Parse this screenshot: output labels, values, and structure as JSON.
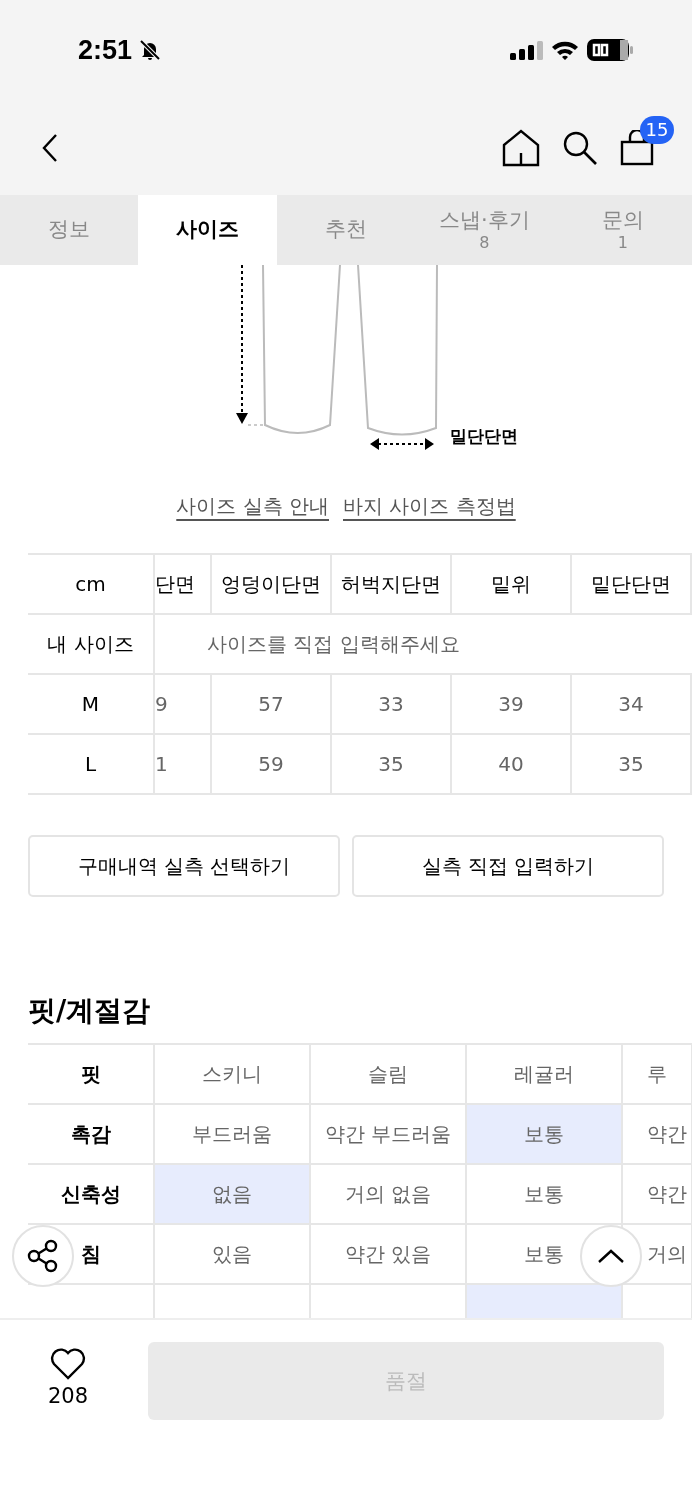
{
  "status_bar": {
    "time": "2:51"
  },
  "nav": {
    "cart_count": "15"
  },
  "tabs": [
    {
      "label": "정보",
      "selected": false
    },
    {
      "label": "사이즈",
      "selected": true
    },
    {
      "label": "추천",
      "selected": false
    },
    {
      "label": "스냅·후기",
      "count": "8",
      "selected": false
    },
    {
      "label": "문의",
      "count": "1",
      "selected": false
    }
  ],
  "diagram": {
    "label": "밀단단면"
  },
  "links": [
    "사이즈 실측 안내",
    "바지 사이즈 측정법"
  ],
  "size_table": {
    "corner": "cm",
    "columns": [
      "단면",
      "엉덩이단면",
      "허벅지단면",
      "밑위",
      "밑단단면"
    ],
    "my_size": {
      "label": "내 사이즈",
      "placeholder": "사이즈를 직접 입력해주세요"
    },
    "rows": [
      {
        "size": "M",
        "values": [
          "9",
          "57",
          "33",
          "39",
          "34"
        ]
      },
      {
        "size": "L",
        "values": [
          "1",
          "59",
          "35",
          "40",
          "35"
        ]
      }
    ]
  },
  "size_buttons": [
    "구매내역 실측 선택하기",
    "실측 직접 입력하기"
  ],
  "fit_section": {
    "title": "핏/계절감",
    "rows": [
      {
        "label": "핏",
        "cells": [
          {
            "text": "스키니",
            "selected": false
          },
          {
            "text": "슬림",
            "selected": false
          },
          {
            "text": "레귤러",
            "selected": false
          },
          {
            "text": "루",
            "selected": false
          }
        ]
      },
      {
        "label": "촉감",
        "cells": [
          {
            "text": "부드러움",
            "selected": false
          },
          {
            "text": "약간 부드러움",
            "selected": false
          },
          {
            "text": "보통",
            "selected": true
          },
          {
            "text": "약간",
            "selected": false
          }
        ]
      },
      {
        "label": "신축성",
        "cells": [
          {
            "text": "없음",
            "selected": true
          },
          {
            "text": "거의 없음",
            "selected": false
          },
          {
            "text": "보통",
            "selected": false
          },
          {
            "text": "약간",
            "selected": false
          }
        ]
      },
      {
        "label": "침",
        "cells": [
          {
            "text": "있음",
            "selected": false
          },
          {
            "text": "약간 있음",
            "selected": false
          },
          {
            "text": "보통",
            "selected": false
          },
          {
            "text": "거의",
            "selected": false
          }
        ]
      },
      {
        "cells": [
          {
            "selected": false
          },
          {
            "selected": false
          },
          {
            "selected": true
          },
          {
            "selected": false
          }
        ]
      }
    ]
  },
  "bottom_bar": {
    "likes": "208",
    "buy_button": {
      "label": "품절",
      "disabled": true
    }
  }
}
